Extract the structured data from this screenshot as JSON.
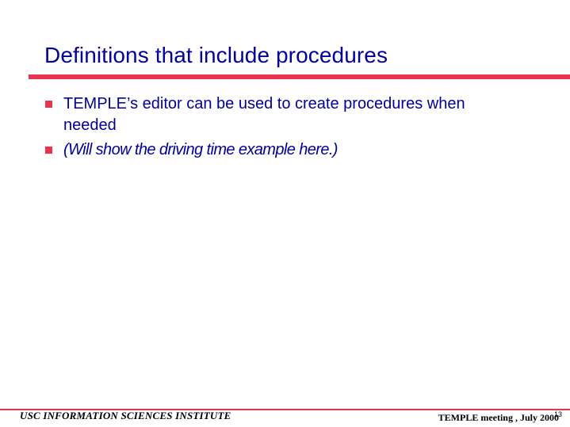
{
  "slide": {
    "title": "Definitions that include procedures",
    "bullets": [
      {
        "text": "TEMPLE’s editor can be used to create procedures when needed",
        "style": "normal"
      },
      {
        "text": "(Will show the driving time example here.)",
        "style": "italic"
      }
    ]
  },
  "footer": {
    "institute": "USC INFORMATION SCIENCES INSTITUTE",
    "meeting": "TEMPLE meeting , July 2000",
    "page_number": "13"
  },
  "colors": {
    "title_text": "#000099",
    "accent_rule": "#e8344e",
    "bullet_square": "#e8344e"
  }
}
